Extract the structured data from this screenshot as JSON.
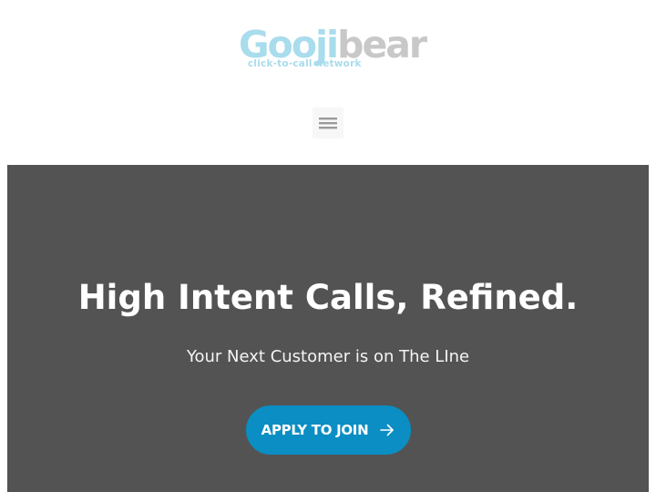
{
  "header": {
    "logo": {
      "word_part_a": "Gooji",
      "word_part_b": "bear",
      "tagline": "click-to-call network",
      "color_primary": "#a9dcec",
      "color_secondary": "#c8c8c8"
    },
    "menu_toggle": {
      "icon": "hamburger-menu-icon"
    }
  },
  "hero": {
    "background_color": "#535353",
    "title": "High Intent Calls, Refined.",
    "subtitle": "Your Next Customer is on The LIne",
    "cta": {
      "label": "APPLY TO JOIN",
      "icon": "arrow-right-icon",
      "color": "#0b8ec3"
    }
  }
}
